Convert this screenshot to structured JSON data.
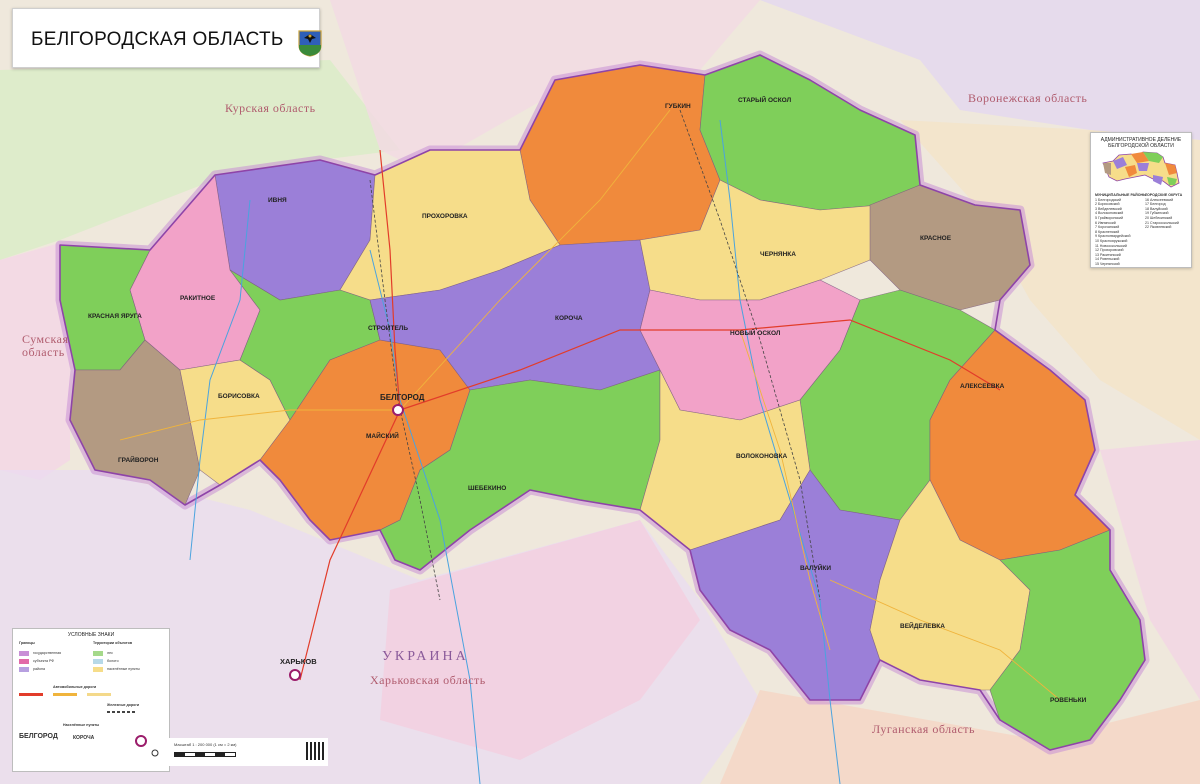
{
  "title": "БЕЛГОРОДСКАЯ ОБЛАСТЬ",
  "neighbors": {
    "kursk": "Курская область",
    "voronezh": "Воронежская область",
    "sumy": "Сумская\nобласть",
    "ukraine": "УКРАИНА",
    "kharkiv": "Харьковская область",
    "lugansk": "Луганская область"
  },
  "cities": {
    "belgorod": "БЕЛГОРОД",
    "stary_oskol": "СТАРЫЙ ОСКОЛ",
    "gubkin": "ГУБКИН",
    "valuyki": "ВАЛУЙКИ",
    "alekseevka": "АЛЕКСЕЕВКА",
    "rovenki": "РОВЕНЬКИ",
    "grayvoron": "ГРАЙВОРОН",
    "shebekino": "ШЕБЕКИНО",
    "novy_oskol": "НОВЫЙ ОСКОЛ",
    "korocha": "КОРОЧА",
    "prokhorovka": "ПРОХОРОВКА",
    "rakitnoe": "РАКИТНОЕ",
    "krasnaya_yaruga": "КРАСНАЯ ЯРУГА",
    "stroitel": "СТРОИТЕЛЬ",
    "ivnya": "ИВНЯ",
    "chernyanka": "ЧЕРНЯНКА",
    "volokonovka": "ВОЛОКОНОВКА",
    "veydelevka": "ВЕЙДЕЛЕВКА",
    "borisovka": "БОРИСОВКА",
    "kharkov": "ХАРЬКОВ",
    "krasnoe": "КРАСНОЕ",
    "maiskiy": "МАЙСКИЙ"
  },
  "inset": {
    "title": "АДМИНИСТРАТИВНОЕ ДЕЛЕНИЕ\nБЕЛГОРОДСКОЙ ОБЛАСТИ",
    "col1_head": "МУНИЦИПАЛЬНЫЕ РАЙОНЫ",
    "col2_head": "ГОРОДСКИЕ ОКРУГА",
    "col1": [
      "1 Белгородский",
      "2 Борисовский",
      "3 Вейделевский",
      "4 Волоконовский",
      "5 Грайворонский",
      "6 Ивнянский",
      "7 Корочанский",
      "8 Красненский",
      "9 Красногвардейский",
      "10 Краснояружский",
      "11 Новооскольский",
      "12 Прохоровский",
      "13 Ракитянский",
      "14 Ровеньский",
      "15 Чернянский"
    ],
    "col2": [
      "16 Алексеевский",
      "17 Белгород",
      "18 Валуйский",
      "19 Губкинский",
      "20 Шебекинский",
      "21 Старооскольский",
      "22 Яковлевский"
    ]
  },
  "legend": {
    "title": "УСЛОВНЫЕ ЗНАКИ",
    "borders_head": "Границы",
    "territory_head": "Территории объектов",
    "roads_head": "Автомобильные дороги",
    "rail_head": "Железные дороги",
    "settlements_head": "Населённые пункты",
    "belgorod_sample": "БЕЛГОРОД",
    "korocha_sample": "КОРОЧА",
    "sample_items": [
      "государственная",
      "субъекта РФ",
      "района",
      "лес",
      "болото",
      "населённые пункты"
    ]
  },
  "scale": "Масштаб 1 : 200 000  (1 см = 2 км)",
  "colors": {
    "orange": "#f08a3c",
    "green": "#7fcf5a",
    "purple": "#9b7fd8",
    "pink": "#f2a2c8",
    "yellow": "#f6dd8a",
    "brown": "#b39a82",
    "outside": "#efe8dc",
    "border": "#8e44a8"
  }
}
